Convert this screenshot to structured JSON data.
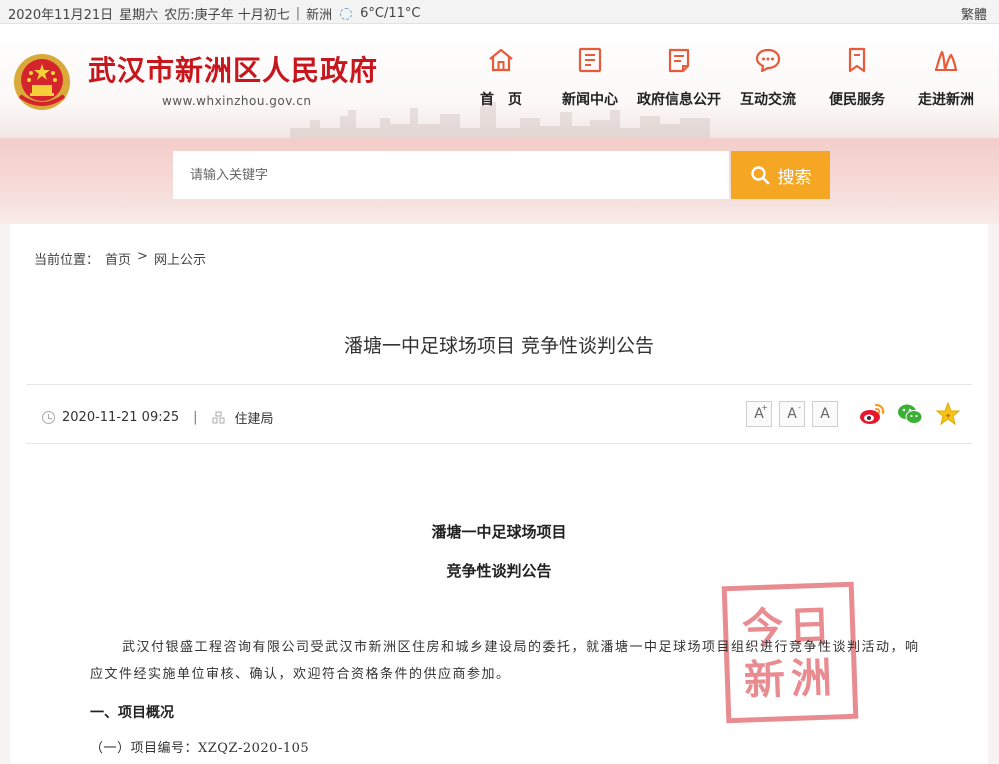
{
  "topbar": {
    "date": "2020年11月21日",
    "weekday": "星期六",
    "lunar": "农历:庚子年 十月初七",
    "separator": "|",
    "location": "新洲",
    "temperature": "6°C/11°C",
    "traditional_label": "繁體"
  },
  "header": {
    "site_title": "武汉市新洲区人民政府",
    "site_url": "www.whxinzhou.gov.cn",
    "nav": [
      {
        "label": "首　页",
        "icon": "home-icon"
      },
      {
        "label": "新闻中心",
        "icon": "news-icon"
      },
      {
        "label": "政府信息公开",
        "icon": "info-open-icon"
      },
      {
        "label": "互动交流",
        "icon": "chat-icon"
      },
      {
        "label": "便民服务",
        "icon": "bookmark-icon"
      },
      {
        "label": "走进新洲",
        "icon": "landmark-icon"
      }
    ],
    "accent_color": "#c8161d"
  },
  "search": {
    "placeholder": "请输入关键字",
    "button_label": "搜索",
    "button_color": "#f5a623"
  },
  "breadcrumb": {
    "prefix": "当前位置：",
    "home": "首页",
    "separator": ">",
    "current": "网上公示"
  },
  "article": {
    "title": "潘塘一中足球场项目 竞争性谈判公告",
    "datetime": "2020-11-21 09:25",
    "meta_separator": "|",
    "source": "住建局",
    "font_buttons": [
      "A",
      "A",
      "A"
    ],
    "font_button_marks": [
      "+",
      "-",
      ""
    ],
    "share_icons": [
      "weibo-icon",
      "wechat-icon",
      "favorite-icon"
    ]
  },
  "document": {
    "heading_1": "潘塘一中足球场项目",
    "heading_2": "竞争性谈判公告",
    "paragraph": "武汉付银盛工程咨询有限公司受武汉市新洲区住房和城乡建设局的委托，就潘塘一中足球场项目组织进行竞争性谈判活动，响应文件经实施单位审核、确认，欢迎符合资格条件的供应商参加。",
    "section_1": "一、项目概况",
    "item_1": "（一）项目编号：XZQZ-2020-105",
    "stamp_line_1": "今日",
    "stamp_line_2": "新洲"
  }
}
